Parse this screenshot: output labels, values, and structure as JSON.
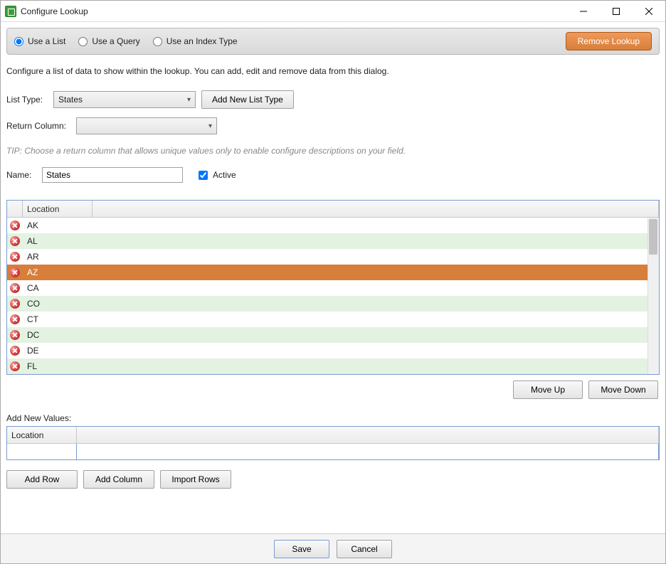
{
  "window": {
    "title": "Configure Lookup"
  },
  "modeBar": {
    "options": [
      {
        "label": "Use a List",
        "checked": true
      },
      {
        "label": "Use a Query",
        "checked": false
      },
      {
        "label": "Use an Index Type",
        "checked": false
      }
    ],
    "removeButton": "Remove Lookup"
  },
  "description": "Configure a list of data to show within the lookup. You can add, edit and remove data from this dialog.",
  "listType": {
    "label": "List Type:",
    "value": "States",
    "addButton": "Add New List Type"
  },
  "returnColumn": {
    "label": "Return Column:",
    "value": "",
    "tip": "TIP: Choose a return column that allows unique values only to enable configure descriptions on your field."
  },
  "nameRow": {
    "label": "Name:",
    "value": "States",
    "activeLabel": "Active",
    "activeChecked": true
  },
  "grid": {
    "header": "Location",
    "rows": [
      {
        "value": "AK",
        "selected": false
      },
      {
        "value": "AL",
        "selected": false
      },
      {
        "value": "AR",
        "selected": false
      },
      {
        "value": "AZ",
        "selected": true
      },
      {
        "value": "CA",
        "selected": false
      },
      {
        "value": "CO",
        "selected": false
      },
      {
        "value": "CT",
        "selected": false
      },
      {
        "value": "DC",
        "selected": false
      },
      {
        "value": "DE",
        "selected": false
      },
      {
        "value": "FL",
        "selected": false
      }
    ]
  },
  "moveButtons": {
    "up": "Move Up",
    "down": "Move Down"
  },
  "addNew": {
    "label": "Add New Values:",
    "header": "Location",
    "input": ""
  },
  "actions": {
    "addRow": "Add Row",
    "addColumn": "Add Column",
    "importRows": "Import Rows"
  },
  "footer": {
    "save": "Save",
    "cancel": "Cancel"
  }
}
